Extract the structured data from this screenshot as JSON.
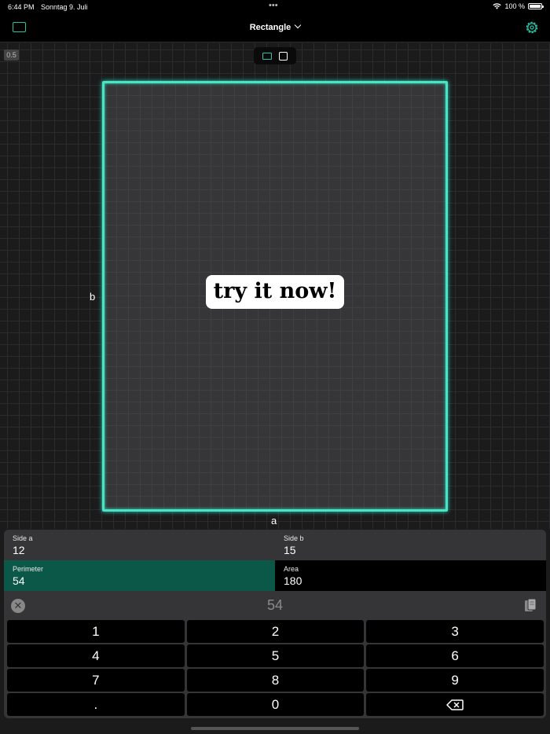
{
  "status_bar": {
    "time": "6:44 PM",
    "date": "Sonntag 9. Juli",
    "battery": "100 %"
  },
  "nav": {
    "title": "Rectangle",
    "left_icon": "rectangle-icon",
    "right_icon": "gear-icon"
  },
  "canvas": {
    "scale": "0.5",
    "shape_selector": [
      "rectangle",
      "square"
    ],
    "label_b": "b",
    "label_a": "a",
    "cta": "try it now!"
  },
  "fields": {
    "side_a": {
      "label": "Side a",
      "value": "12"
    },
    "side_b": {
      "label": "Side b",
      "value": "15"
    },
    "perimeter": {
      "label": "Perimeter",
      "value": "54"
    },
    "area": {
      "label": "Area",
      "value": "180"
    }
  },
  "display": {
    "value": "54"
  },
  "keypad": [
    "1",
    "2",
    "3",
    "4",
    "5",
    "6",
    "7",
    "8",
    "9",
    ".",
    "0"
  ],
  "colors": {
    "accent": "#27c2a4",
    "selected_field": "#0b5748",
    "outline": "#49e3c6"
  }
}
